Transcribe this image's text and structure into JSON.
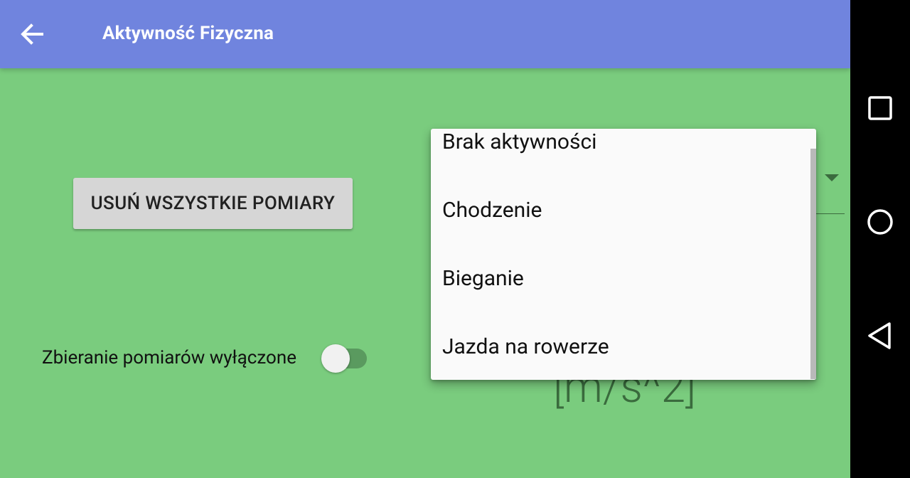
{
  "appbar": {
    "title": "Aktywność Fizyczna",
    "back_icon": "arrow-left-icon"
  },
  "main": {
    "delete_button_label": "USUŃ WSZYSTKIE POMIARY",
    "collection_switch": {
      "label": "Zbieranie pomiarów wyłączone",
      "checked": false
    },
    "unit_text": "[m/s^2]"
  },
  "dropdown": {
    "options": [
      "Brak aktywności",
      "Chodzenie",
      "Bieganie",
      "Jazda na rowerze"
    ]
  },
  "system_nav": {
    "recents_icon": "square-icon",
    "home_icon": "circle-icon",
    "back_icon": "triangle-back-icon"
  },
  "colors": {
    "appbar": "#7084de",
    "background": "#7acc7e",
    "button": "#d6d6d6",
    "dropdown": "#fafafa"
  }
}
